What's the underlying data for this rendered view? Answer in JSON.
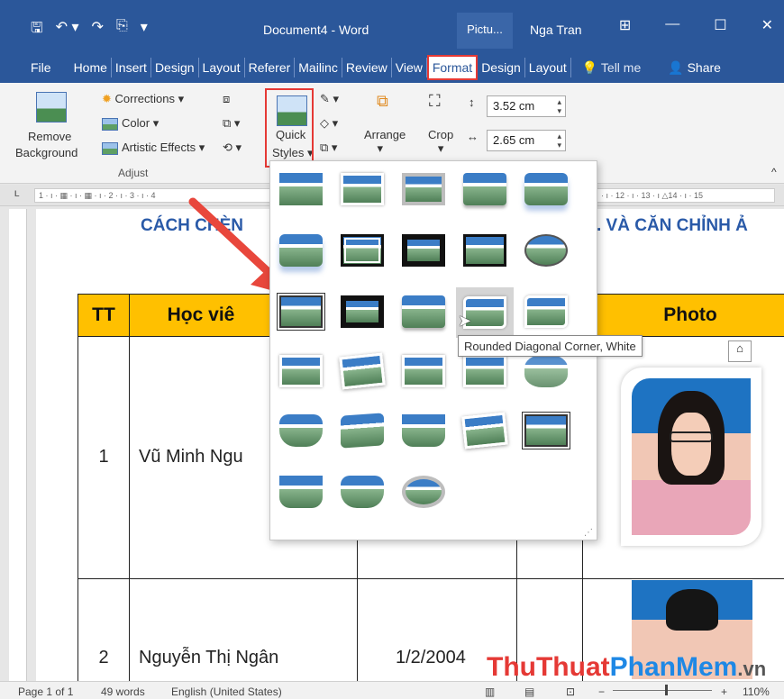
{
  "titlebar": {
    "document_title": "Document4  -  Word",
    "context_tab": "Pictu...",
    "user": "Nga Tran",
    "save_icon": "save-icon",
    "undo_icon": "undo-icon",
    "redo_icon": "redo-icon"
  },
  "tabs": [
    "File",
    "Home",
    "Insert",
    "Design",
    "Layout",
    "Referer",
    "Mailinc",
    "Review",
    "View",
    "Format",
    "Design",
    "Layout"
  ],
  "active_tab": "Format",
  "tell_me": "Tell me",
  "share": "Share",
  "ribbon": {
    "remove_bg_line1": "Remove",
    "remove_bg_line2": "Background",
    "corrections": "Corrections",
    "color": "Color",
    "artistic_effects": "Artistic Effects",
    "quick_styles_line1": "Quick",
    "quick_styles_line2": "Styles",
    "arrange": "Arrange",
    "crop": "Crop",
    "height": "3.52 cm",
    "width": "2.65 cm",
    "group_adjust": "Adjust"
  },
  "ruler": {
    "left_ticks": "1 · ı · ▦ · ı · ▦ · ı · 2 · ı · 3 · ı · 4",
    "right_ticks": "· ı · 12 · ı · 13 · ı △14 · ı · 15"
  },
  "document": {
    "heading_left": "CÁCH CHÈN",
    "heading_right": ". VÀ CĂN CHỈNH Ả",
    "col_tt": "TT",
    "col_name": "Học viê",
    "col_photo": "Photo",
    "row1_num": "1",
    "row1_name": "Vũ Minh Ngu",
    "row2_num": "2",
    "row2_name": "Nguyễn Thị Ngân",
    "row2_date": "1/2/2004"
  },
  "gallery": {
    "tooltip": "Rounded Diagonal Corner, White",
    "hovered_index": 13
  },
  "status": {
    "page": "Page 1 of 1",
    "words": "49 words",
    "language": "English (United States)",
    "zoom": "110%"
  },
  "watermark": {
    "part1": "Thu",
    "part2": "Thuat",
    "part3": "PhanMem",
    "part4": ".vn"
  },
  "colors": {
    "title_blue": "#2b579a",
    "header_yellow": "#ffc000",
    "highlight_red": "#e53935",
    "heading_blue": "#2a5aa8"
  }
}
